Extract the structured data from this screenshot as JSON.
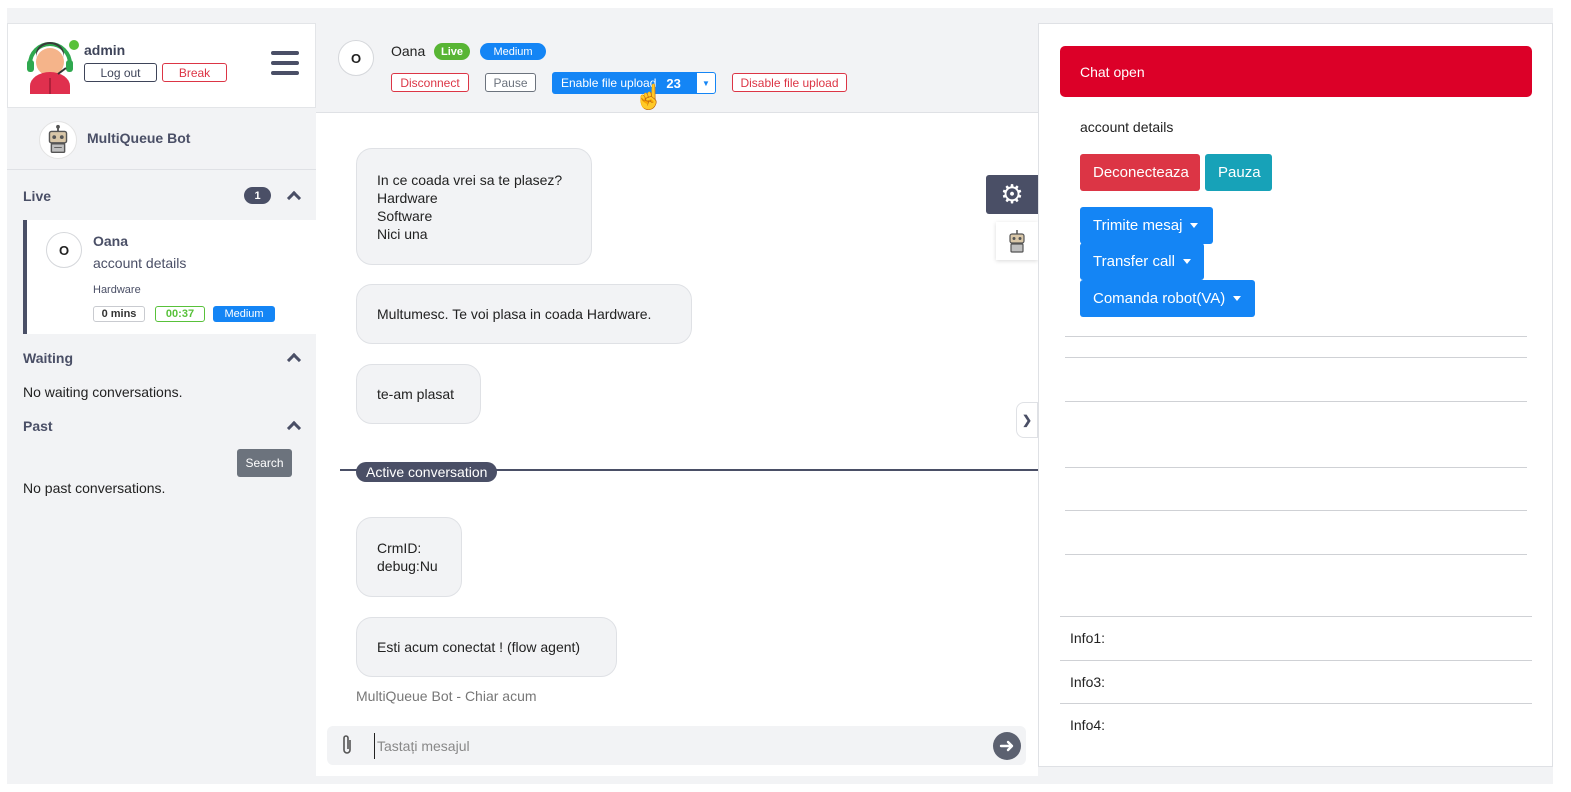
{
  "user": {
    "name": "admin",
    "logout_label": "Log out",
    "break_label": "Break"
  },
  "sidebar": {
    "bot_name": "MultiQueue Bot",
    "live": {
      "title": "Live",
      "count": "1"
    },
    "live_conversation": {
      "initial": "O",
      "name": "Oana",
      "subject": "account details",
      "queue": "Hardware",
      "wait": "0 mins",
      "timer": "00:37",
      "priority": "Medium"
    },
    "waiting": {
      "title": "Waiting",
      "empty": "No waiting conversations."
    },
    "past": {
      "title": "Past",
      "search_label": "Search",
      "empty": "No past conversations."
    }
  },
  "chat": {
    "header": {
      "initial": "O",
      "name": "Oana",
      "status": "Live",
      "priority": "Medium",
      "disconnect_label": "Disconnect",
      "pause_label": "Pause",
      "enable_upload_label": "Enable file upload",
      "enable_upload_count": "23",
      "disable_upload_label": "Disable file upload"
    },
    "messages": [
      "In ce coada vrei sa te plasez?\nHardware\nSoftware\nNici una",
      "Multumesc. Te voi plasa in coada Hardware.",
      "te-am plasat",
      "CrmID:\ndebug:Nu",
      "Esti acum conectat ! (flow agent)"
    ],
    "active_label": "Active conversation",
    "meta": "MultiQueue Bot -  Chiar acum",
    "input_placeholder": "Tastați mesajul"
  },
  "panel": {
    "status": "Chat open",
    "subject": "account details",
    "deconnect_label": "Deconecteaza",
    "pause_label": "Pauza",
    "send_label": "Trimite mesaj",
    "transfer_label": "Transfer call",
    "robot_label": "Comanda robot(VA)",
    "info": [
      "Info1:",
      "Info3:",
      "Info4:"
    ]
  },
  "colors": {
    "accent": "#1485f5",
    "danger": "#dc3545",
    "chat_open": "#dc0028",
    "live": "#58b534",
    "dark": "#4a4f66",
    "info": "#17a2b8"
  },
  "icons": [
    "agent-avatar-icon",
    "hamburger-icon",
    "robot-icon",
    "chevron-up-icon",
    "gear-icon",
    "chevron-right-icon",
    "paperclip-icon",
    "send-arrow-icon",
    "hand-cursor-icon"
  ]
}
